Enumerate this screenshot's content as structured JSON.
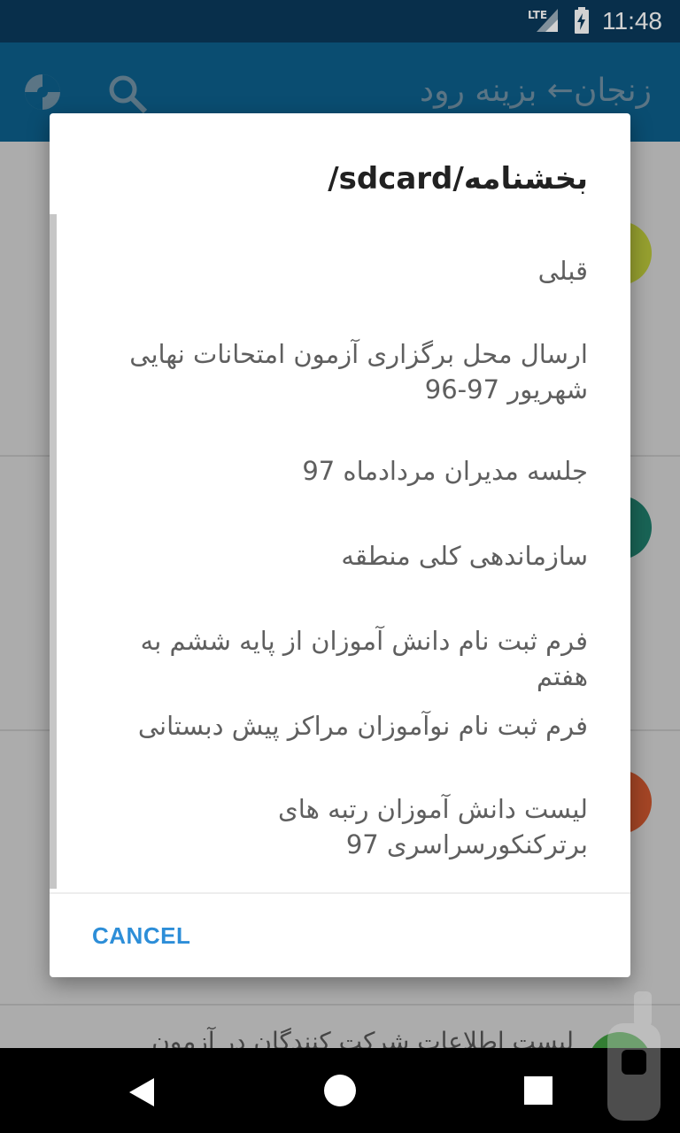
{
  "status_bar": {
    "network": "LTE",
    "time": "11:48"
  },
  "app_bar": {
    "title": "زنجان← بزینه رود"
  },
  "background": {
    "partial_row_text": "لیست اطلاعات شرکت کنندگان در آزمون"
  },
  "dialog": {
    "title": "/sdcard/بخشنامه",
    "items": [
      "قبلی",
      "ارسال محل برگزاری آزمون امتحانات نهایی شهریور 97-96",
      "جلسه مدیران مردادماه 97",
      "سازماندهی کلی منطقه",
      "فرم ثبت نام دانش آموزان از پایه ششم به هفتم",
      "فرم ثبت نام نوآموزان مراکز پیش دبستانی",
      "لیست دانش آموزان رتبه های برترکنکورسراسری 97"
    ],
    "cancel_label": "CANCEL"
  },
  "colors": {
    "status_bar": "#0a3a5c",
    "app_bar": "#0d5f8a",
    "accent": "#2d8ed8",
    "circle_1": "#b8c43a",
    "circle_2": "#1f7a6a",
    "circle_3": "#c8552e",
    "circle_4": "#3f9a3f"
  },
  "icons": {
    "search": "search-icon",
    "logo": "logo-icon",
    "back": "back-icon",
    "home": "home-icon",
    "recents": "recents-icon"
  }
}
